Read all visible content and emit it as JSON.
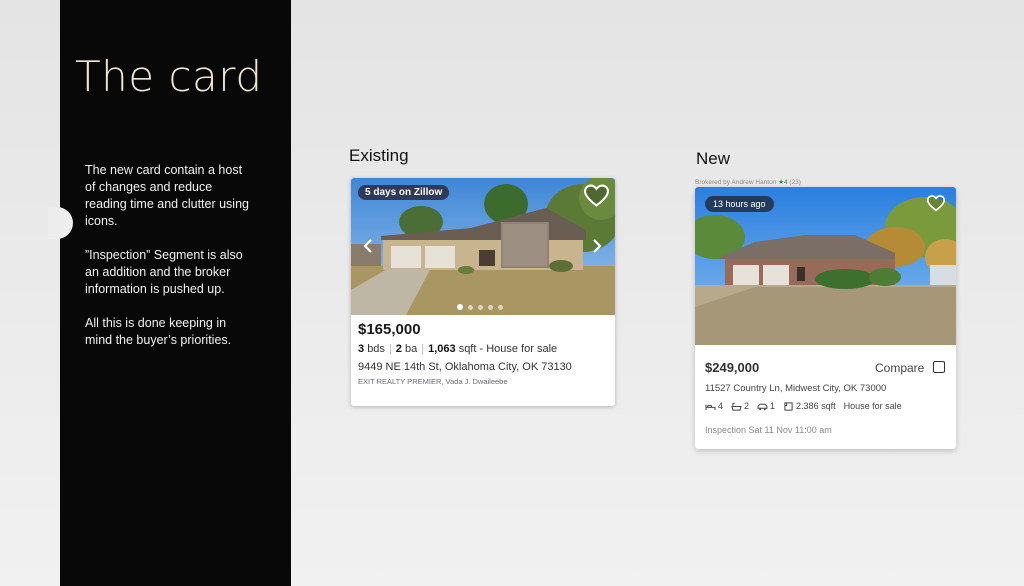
{
  "sidebar": {
    "title": "The card",
    "paragraphs": [
      "The new card contain a host of changes and reduce reading time and clutter using icons.",
      "”Inspection” Segment is also an addition and the broker information is pushed up.",
      "All this is done keeping in mind the buyer’s priorities."
    ]
  },
  "existing": {
    "label": "Existing",
    "badge": "5 days on Zillow",
    "price": "$165,000",
    "beds": "3",
    "beds_unit": "bds",
    "baths": "2",
    "baths_unit": "ba",
    "sqft": "1,063",
    "sqft_unit": "sqft",
    "type": "- House for sale",
    "address": "9449 NE 14th St, Oklahoma City, OK 73130",
    "broker": "EXIT REALTY PREMIER, Vada J. Dwaileebe",
    "photo_count": 5,
    "active_photo": 1
  },
  "new_card": {
    "label": "New",
    "brokered_by": "Brokered by Andrew Hanton",
    "rating": "4",
    "reviews": "(23)",
    "badge": "13 hours ago",
    "price": "$249,000",
    "compare_label": "Compare",
    "address": "11527 Country Ln, Midwest City, OK 73000",
    "beds": "4",
    "baths": "2",
    "garage": "1",
    "sqft": "2.386 sqft",
    "type": "House for sale",
    "inspection": "Inspection Sat 11 Nov 11:00 am"
  },
  "colors": {
    "sidebar_bg": "#080808",
    "title_color": "#efe6d6",
    "rating_star": "#1e8f3a"
  }
}
